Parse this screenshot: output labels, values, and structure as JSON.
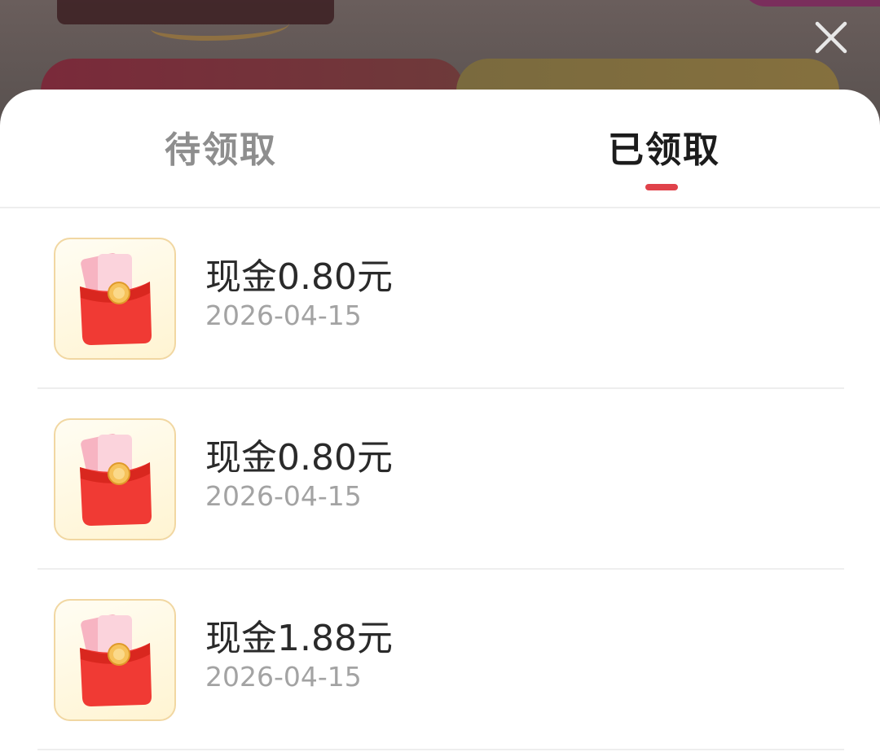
{
  "close": {
    "icon": "close-icon"
  },
  "tabs": {
    "pending_label": "待领取",
    "claimed_label": "已领取",
    "active": "claimed",
    "indicator_color": "#e0424a"
  },
  "records": [
    {
      "title": "现金0.80元",
      "date": "2026-04-15",
      "icon": "red-envelope-icon"
    },
    {
      "title": "现金0.80元",
      "date": "2026-04-15",
      "icon": "red-envelope-icon"
    },
    {
      "title": "现金1.88元",
      "date": "2026-04-15",
      "icon": "red-envelope-icon"
    }
  ]
}
